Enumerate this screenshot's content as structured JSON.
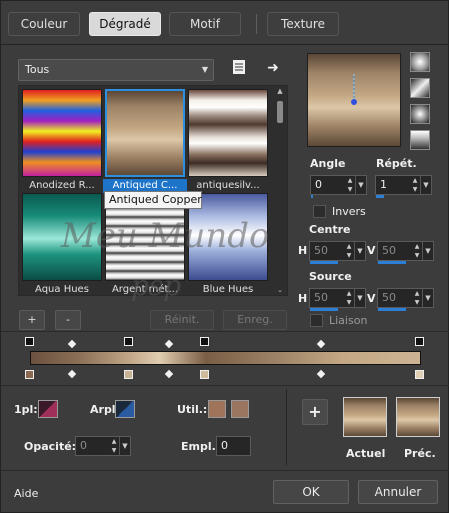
{
  "tabs": [
    {
      "label": "Couleur"
    },
    {
      "label": "Dégradé"
    },
    {
      "label": "Motif"
    },
    {
      "label": "Texture"
    }
  ],
  "category": {
    "selected": "Tous"
  },
  "gallery": {
    "items": [
      {
        "label": "Anodized R..."
      },
      {
        "label": "Antiqued C..."
      },
      {
        "label": "antiquesilv..."
      },
      {
        "label": "Aqua Hues"
      },
      {
        "label": "Argent mét..."
      },
      {
        "label": "Blue Hues"
      }
    ],
    "tooltip": "Antiqued Copper"
  },
  "gallery_buttons": {
    "add": "+",
    "remove": "-",
    "reset": "Réinit.",
    "save": "Enreg."
  },
  "angle": {
    "label": "Angle",
    "value": "0"
  },
  "repeat": {
    "label": "Répét.",
    "value": "1"
  },
  "invert": {
    "label": "Invers"
  },
  "centre": {
    "label": "Centre",
    "h_label": "H",
    "h": "50",
    "v_label": "V",
    "v": "50"
  },
  "source": {
    "label": "Source",
    "h_label": "H",
    "h": "50",
    "v_label": "V",
    "v": "50"
  },
  "link": {
    "label": "Liaison"
  },
  "stops": {
    "first_label": "1pl:",
    "arpl_label": "Arpl:",
    "util_label": "Util.:",
    "opacity_label": "Opacité:",
    "opacity_value": "0",
    "empl_label": "Empl.:",
    "empl_value": "0"
  },
  "previews": {
    "current_label": "Actuel",
    "previous_label": "Préc."
  },
  "footer": {
    "help": "Aide",
    "ok": "OK",
    "cancel": "Annuler"
  },
  "watermark": {
    "line1": "Meu Mundo",
    "line2": "psp"
  },
  "colors": {
    "selection": "#2d8fe0",
    "copper_dark": "#5a4636",
    "copper_light": "#c4a884",
    "stop_brown": "#a0745a"
  }
}
